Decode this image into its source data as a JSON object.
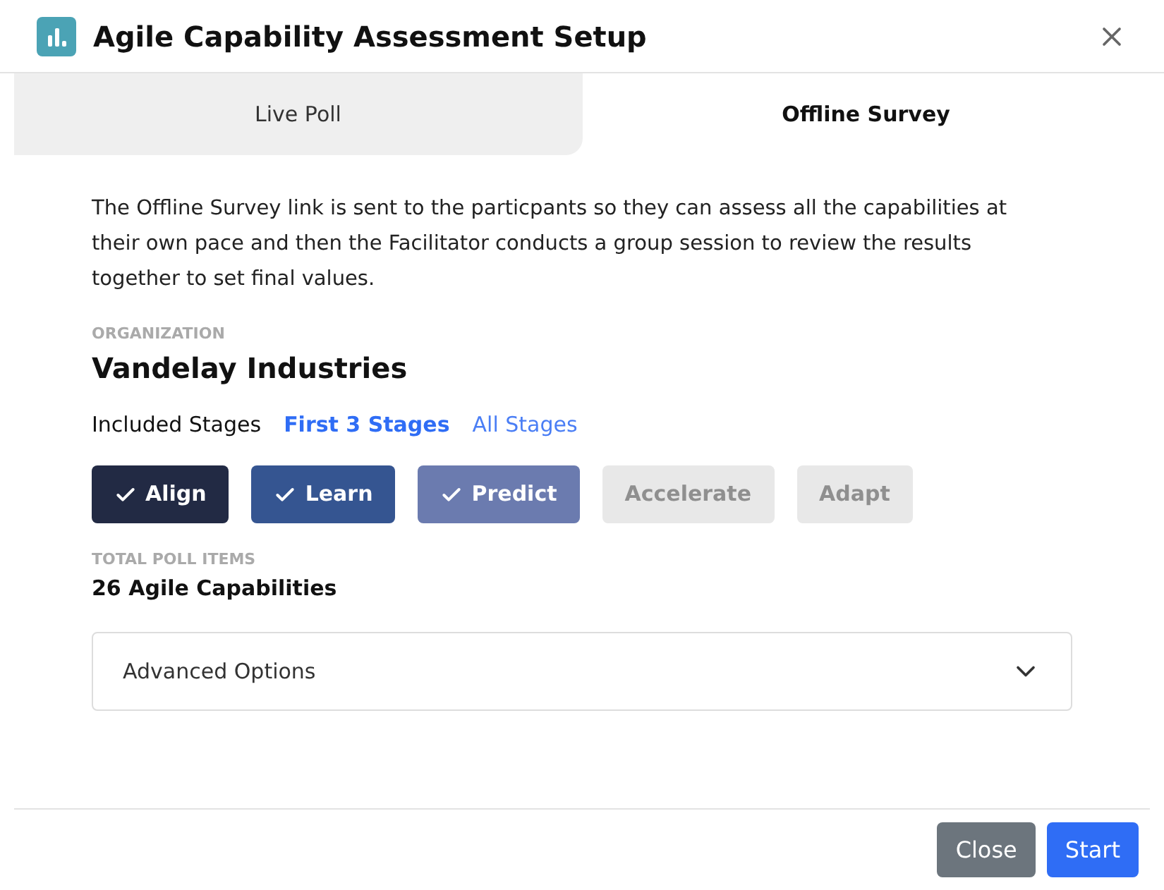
{
  "window": {
    "title": "Agile Capability Assessment Setup"
  },
  "tabs": [
    {
      "label": "Live Poll",
      "selected": false
    },
    {
      "label": "Offline Survey",
      "selected": true
    }
  ],
  "description": "The Offline Survey link is sent to the particpants so they can assess all the capabilities at their own pace and then the Facilitator conducts a group session to review the results together to set final values.",
  "organization": {
    "label": "ORGANIZATION",
    "value": "Vandelay Industries"
  },
  "stage_filter": {
    "label": "Included Stages",
    "options": [
      {
        "label": "First 3 Stages",
        "selected": true
      },
      {
        "label": "All Stages",
        "selected": false
      }
    ]
  },
  "stages": [
    {
      "label": "Align",
      "selected": true,
      "color": "#222a44"
    },
    {
      "label": "Learn",
      "selected": true,
      "color": "#355591"
    },
    {
      "label": "Predict",
      "selected": true,
      "color": "#6b7baf"
    },
    {
      "label": "Accelerate",
      "selected": false,
      "color": "#e8e8e8"
    },
    {
      "label": "Adapt",
      "selected": false,
      "color": "#e8e8e8"
    }
  ],
  "total": {
    "label": "TOTAL POLL ITEMS",
    "value": "26 Agile Capabilities"
  },
  "advanced_options": {
    "label": "Advanced Options",
    "expanded": false
  },
  "buttons": [
    {
      "label": "Close",
      "kind": "secondary"
    },
    {
      "label": "Start",
      "kind": "primary"
    }
  ]
}
